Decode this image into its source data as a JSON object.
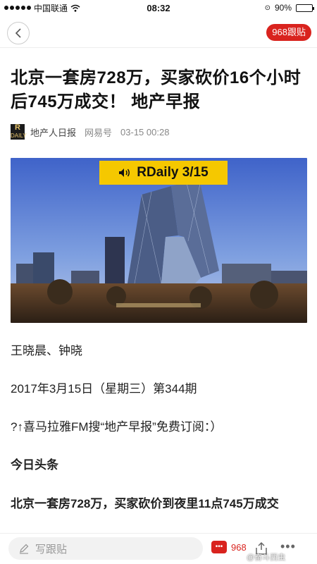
{
  "status_bar": {
    "carrier": "中国联通",
    "time": "08:32",
    "battery": "90%",
    "battery_level": 0.9
  },
  "nav": {
    "follow_count_label": "968跟贴"
  },
  "article": {
    "title": "北京一套房728万，买家砍价16个小时后745万成交！ 地产早报",
    "source": "地产人日报",
    "platform": "网易号",
    "datetime": "03-15 00:28",
    "logo_text_top": "R",
    "logo_text_bottom": "DAILY",
    "hero_badge": "RDaily 3/15",
    "author": "王晓晨、钟晓",
    "issue_date": "2017年3月15日（星期三）第344期",
    "subscribe_text": "?↑喜马拉雅FM搜“地产早报”免费订阅：）",
    "section_heading": "今日头条",
    "lead": "北京一套房728万，买家砍价到夜里11点745万成交"
  },
  "bottom_bar": {
    "comment_placeholder": "写跟贴",
    "comment_count": "968",
    "watermark": "@奋斗西虫"
  },
  "colors": {
    "accent": "#d9231e",
    "badge": "#f5c800"
  },
  "icons": [
    "back-arrow-icon",
    "speaker-icon",
    "pencil-icon",
    "comment-bubble-icon",
    "share-icon",
    "more-icon",
    "wifi-icon",
    "lock-icon"
  ]
}
